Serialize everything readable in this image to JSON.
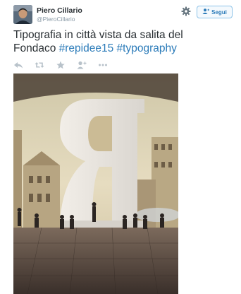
{
  "tweet": {
    "display_name": "Piero Cillario",
    "username": "@PieroCillario",
    "text_part1": "Tipografia in città  vista da salita del",
    "text_part2": "Fondaco",
    "hashtag1": "#repidee15",
    "hashtag2": "#typography"
  },
  "follow_button": {
    "label": "Segui"
  },
  "icons": {
    "settings": "gear-icon",
    "reply": "reply-icon",
    "retweet": "retweet-icon",
    "favorite": "star-icon",
    "follow": "add-user-icon",
    "more": "more-icon"
  },
  "colors": {
    "link": "#2b7bb9",
    "muted": "#8899a6",
    "text": "#292f33",
    "follow_border": "#8ec3e8"
  }
}
